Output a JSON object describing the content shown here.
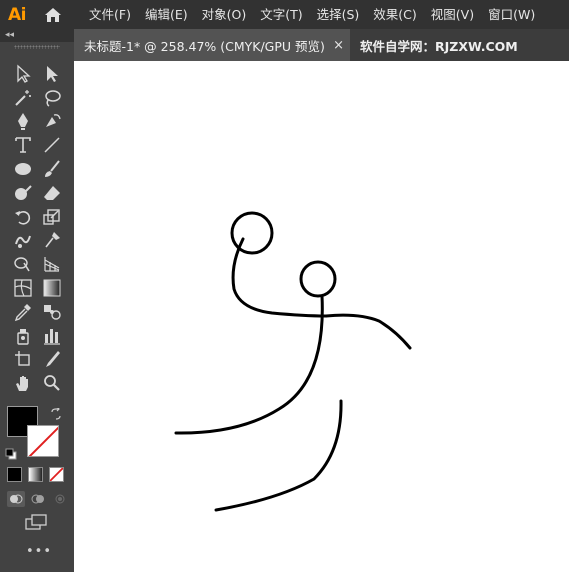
{
  "app": {
    "logo_text": "Ai"
  },
  "menu": {
    "items": [
      {
        "label": "文件(F)"
      },
      {
        "label": "编辑(E)"
      },
      {
        "label": "对象(O)"
      },
      {
        "label": "文字(T)"
      },
      {
        "label": "选择(S)"
      },
      {
        "label": "效果(C)"
      },
      {
        "label": "视图(V)"
      },
      {
        "label": "窗口(W)"
      }
    ]
  },
  "toolbar": {
    "collapse_label": "◂◂",
    "more_label": "•••",
    "tools": [
      "selection-tool",
      "direct-selection-tool",
      "magic-wand-tool",
      "lasso-tool",
      "pen-tool",
      "curvature-tool",
      "type-tool",
      "line-segment-tool",
      "ellipse-tool",
      "paintbrush-tool",
      "shaper-tool",
      "eraser-tool",
      "rotate-tool",
      "scale-tool",
      "warp-tool",
      "puppet-warp-tool",
      "shape-builder-tool",
      "perspective-grid-tool",
      "mesh-tool",
      "gradient-tool",
      "eyedropper-tool",
      "blend-tool",
      "symbol-sprayer-tool",
      "column-graph-tool",
      "artboard-tool",
      "slice-tool",
      "hand-tool",
      "zoom-tool"
    ],
    "fill_color": "#000000",
    "stroke_color": "#ffffff"
  },
  "tabs": [
    {
      "label": "未标题-1* @ 258.47% (CMYK/GPU 预览)",
      "close_label": "×",
      "active": true
    },
    {
      "label": "软件自学网：RJZXW.COM",
      "active": false
    }
  ],
  "colors": {
    "menubar_bg": "#323232",
    "panel_bg": "#424242",
    "workspace_bg": "#535353",
    "accent": "#ff9a00",
    "stroke": "#000000"
  }
}
